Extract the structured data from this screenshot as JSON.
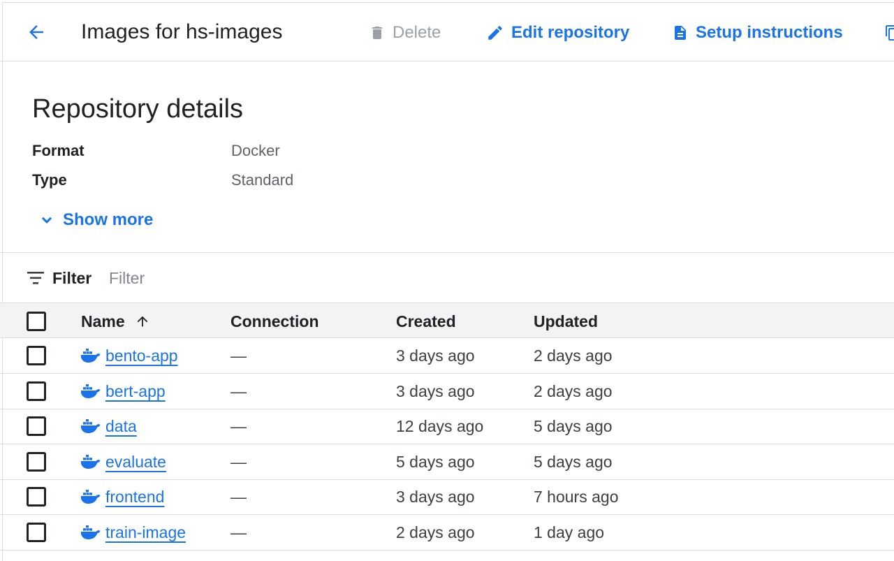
{
  "header": {
    "title": "Images for hs-images",
    "delete_label": "Delete",
    "edit_label": "Edit repository",
    "setup_label": "Setup instructions"
  },
  "details": {
    "title": "Repository details",
    "format_label": "Format",
    "format_value": "Docker",
    "type_label": "Type",
    "type_value": "Standard",
    "show_more_label": "Show more"
  },
  "filter": {
    "label": "Filter",
    "placeholder": "Filter"
  },
  "table": {
    "columns": {
      "name": "Name",
      "connection": "Connection",
      "created": "Created",
      "updated": "Updated"
    },
    "sort": "ascending",
    "rows": [
      {
        "name": "bento-app",
        "connection": "—",
        "created": "3 days ago",
        "updated": "2 days ago"
      },
      {
        "name": "bert-app",
        "connection": "—",
        "created": "3 days ago",
        "updated": "2 days ago"
      },
      {
        "name": "data",
        "connection": "—",
        "created": "12 days ago",
        "updated": "5 days ago"
      },
      {
        "name": "evaluate",
        "connection": "—",
        "created": "5 days ago",
        "updated": "5 days ago"
      },
      {
        "name": "frontend",
        "connection": "—",
        "created": "3 days ago",
        "updated": "7 hours ago"
      },
      {
        "name": "train-image",
        "connection": "—",
        "created": "2 days ago",
        "updated": "1 day ago"
      }
    ]
  },
  "colors": {
    "accent": "#1a73e8",
    "disabled": "#9aa0a6",
    "border": "#dadce0",
    "header_bg": "#f1f3f4"
  },
  "icons": {
    "back": "arrow-back-icon",
    "delete": "trash-icon",
    "edit": "pencil-icon",
    "setup": "document-icon",
    "copy": "copy-icon",
    "show_more": "chevron-down-icon",
    "filter": "filter-icon",
    "sort": "arrow-up-icon",
    "row": "docker-icon"
  }
}
